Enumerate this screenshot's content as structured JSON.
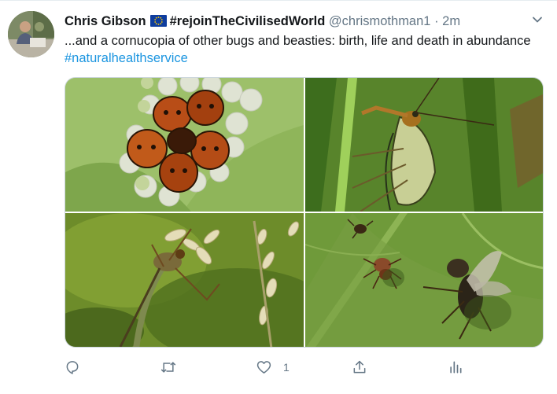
{
  "tweet": {
    "author_name": "Chris Gibson",
    "author_flag_icon": "eu-flag-icon",
    "author_name_suffix": "#rejoinTheCivilisedWorld",
    "handle": "@chrismothman1",
    "separator": "·",
    "time": "2m",
    "text": "...and a cornucopia of other bugs and beasties: birth, life and death in abundance ",
    "hashtag": "#naturalhealthservice",
    "menu_icon": "chevron-down-icon"
  },
  "media": {
    "photos": [
      {
        "subject": "shieldbug nymphs on egg cluster"
      },
      {
        "subject": "scorpionfly on grass stem"
      },
      {
        "subject": "fly on grass flower head"
      },
      {
        "subject": "spider and fly on leaf"
      }
    ]
  },
  "actions": {
    "reply_icon": "reply-icon",
    "retweet_icon": "retweet-icon",
    "like_icon": "heart-icon",
    "like_count": "1",
    "share_icon": "share-icon",
    "analytics_icon": "analytics-icon"
  },
  "colors": {
    "link": "#1b95e0",
    "secondary_text": "#657786",
    "primary_text": "#14171a"
  }
}
